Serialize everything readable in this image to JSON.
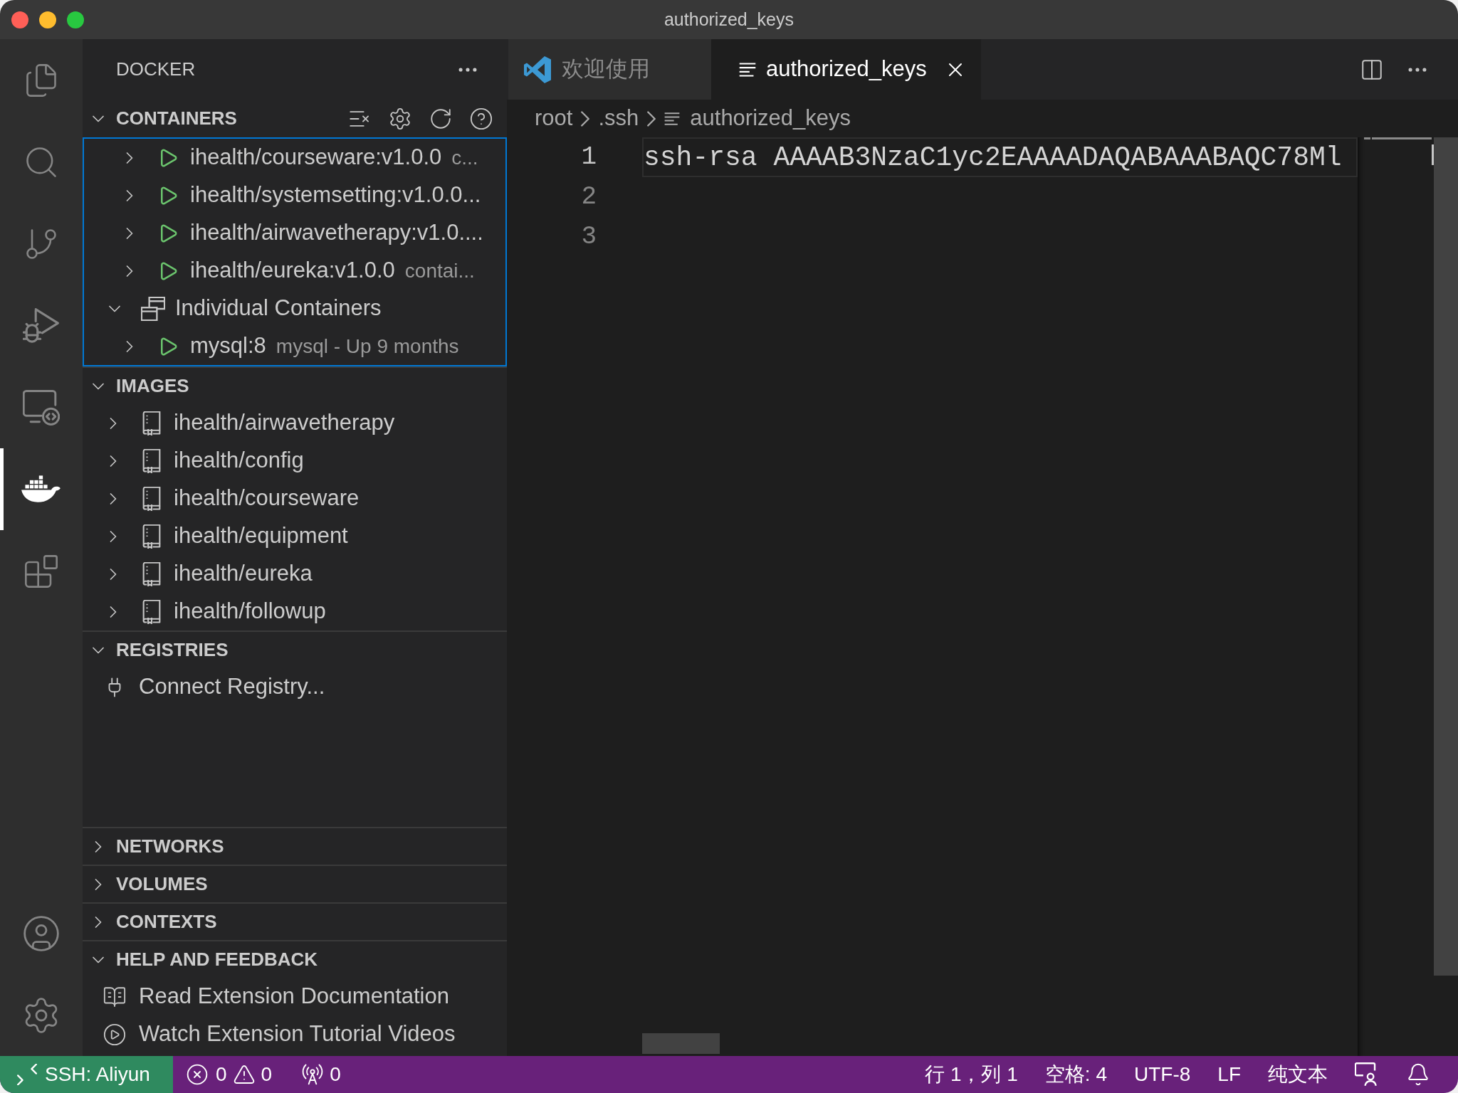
{
  "window": {
    "title": "authorized_keys"
  },
  "activity_bar": {
    "items": [
      {
        "kind": "explorer",
        "selected": false
      },
      {
        "kind": "search",
        "selected": false
      },
      {
        "kind": "source_control",
        "selected": false
      },
      {
        "kind": "run_debug",
        "selected": false
      },
      {
        "kind": "remote",
        "selected": false
      },
      {
        "kind": "docker",
        "selected": true
      },
      {
        "kind": "extensions",
        "selected": false
      }
    ]
  },
  "sidebar": {
    "title": "DOCKER",
    "sections": [
      {
        "kind": "containers",
        "title": "CONTAINERS",
        "expanded": true,
        "focused": true,
        "items": [
          {
            "children": [
              {
                "kind": "container",
                "label": "ihealth/courseware:v1.0.0",
                "description": "c...",
                "expanded": false
              },
              {
                "kind": "container",
                "label": "ihealth/systemsetting:v1.0.0...",
                "expanded": false
              },
              {
                "kind": "container",
                "label": "ihealth/airwavetherapy:v1.0....",
                "expanded": false
              },
              {
                "kind": "container",
                "label": "ihealth/eureka:v1.0.0",
                "description": "contai...",
                "expanded": false
              }
            ]
          },
          {
            "kind": "group",
            "label": "Individual Containers",
            "expanded": true,
            "children": [
              {
                "kind": "container",
                "label": "mysql:8",
                "description": "mysql - Up 9 months",
                "expanded": false
              }
            ]
          }
        ]
      },
      {
        "kind": "images",
        "title": "IMAGES",
        "expanded": true,
        "focused": false,
        "items": [
          {
            "kind": "image",
            "label": "ihealth/airwavetherapy",
            "expanded": false
          },
          {
            "kind": "image",
            "label": "ihealth/config",
            "expanded": false
          },
          {
            "kind": "image",
            "label": "ihealth/courseware",
            "expanded": false
          },
          {
            "kind": "image",
            "label": "ihealth/equipment",
            "expanded": false
          },
          {
            "kind": "image",
            "label": "ihealth/eureka",
            "expanded": false
          },
          {
            "kind": "image",
            "label": "ihealth/followup",
            "expanded": false
          }
        ]
      },
      {
        "kind": "registries",
        "title": "REGISTRIES",
        "expanded": true,
        "focused": false,
        "items": [
          {
            "kind": "connect",
            "label": "Connect Registry..."
          }
        ]
      },
      {
        "kind": "networks",
        "title": "NETWORKS",
        "expanded": false,
        "focused": false
      },
      {
        "kind": "volumes",
        "title": "VOLUMES",
        "expanded": false,
        "focused": false
      },
      {
        "kind": "contexts",
        "title": "CONTEXTS",
        "expanded": false,
        "focused": false
      },
      {
        "kind": "help",
        "title": "HELP AND FEEDBACK",
        "expanded": true,
        "focused": false,
        "items": [
          {
            "kind": "docs",
            "label": "Read Extension Documentation"
          },
          {
            "kind": "video",
            "label": "Watch Extension Tutorial Videos"
          }
        ]
      }
    ]
  },
  "editor": {
    "tabs": [
      {
        "kind": "welcome",
        "label": "欢迎使用",
        "selected": false
      },
      {
        "kind": "file",
        "label": "authorized_keys",
        "selected": true
      }
    ],
    "breadcrumbs": [
      "root",
      ".ssh",
      "authorized_keys"
    ],
    "lines": [
      {
        "number": "1",
        "text": "ssh-rsa AAAAB3NzaC1yc2EAAAADAQABAAABAQC78Ml",
        "current": true
      },
      {
        "number": "2",
        "current": false
      },
      {
        "number": "3",
        "current": false
      }
    ]
  },
  "status_bar": {
    "remote": "SSH: Aliyun",
    "left": [
      {
        "kind": "errors",
        "text": "0"
      },
      {
        "kind": "warnings",
        "text": "0"
      },
      {
        "kind": "ports",
        "text": "0"
      }
    ],
    "right": [
      "行 1，列 1",
      "空格: 4",
      "UTF-8",
      "LF",
      "纯文本"
    ]
  }
}
